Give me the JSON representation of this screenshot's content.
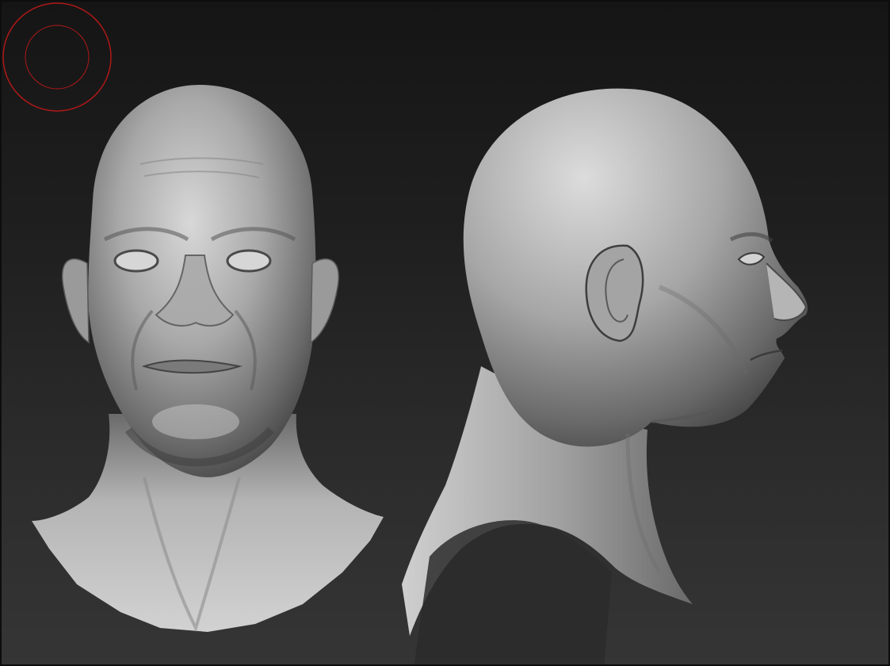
{
  "viewport": {
    "background_top": "#151515",
    "background_bottom": "#353535",
    "model_color": "#a9a9a9"
  },
  "views": [
    {
      "name": "front-view",
      "label": ""
    },
    {
      "name": "side-view",
      "label": ""
    }
  ],
  "gizmo": {
    "icon": "rotation-gizmo-icon",
    "color": "#b01818"
  }
}
